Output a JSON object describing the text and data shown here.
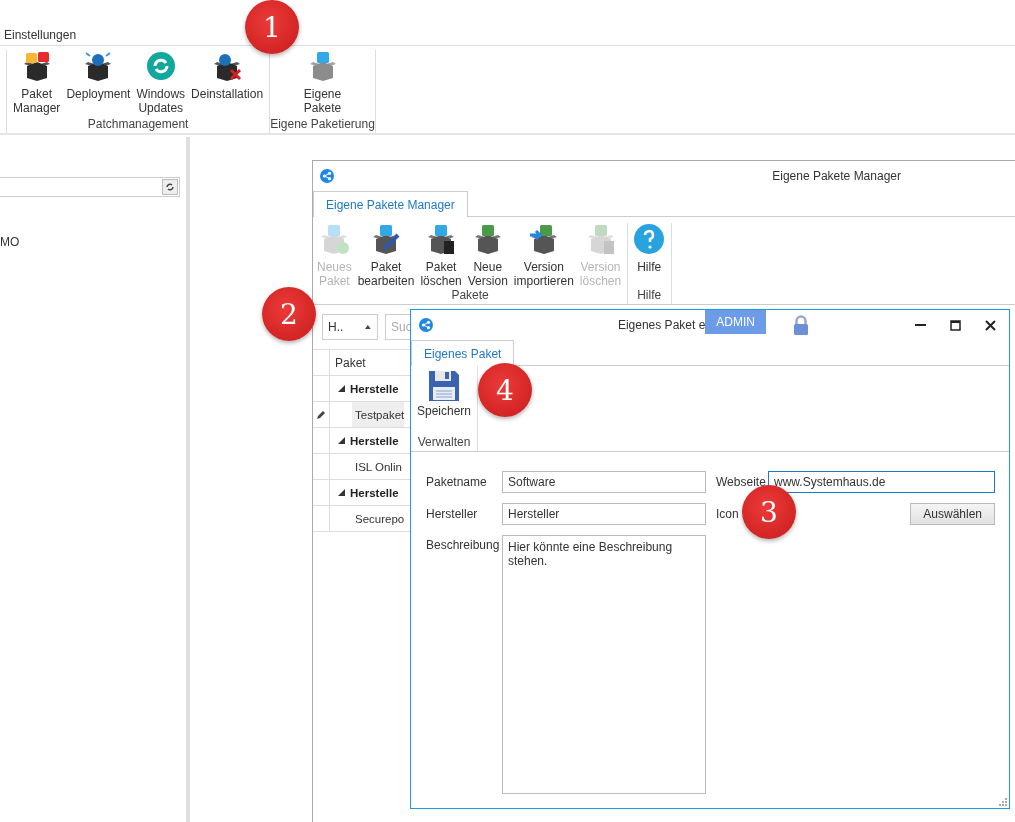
{
  "menu_tab": "Einstellungen",
  "ribbon_groups": [
    {
      "label": "Patchmanagement",
      "buttons": [
        {
          "label": "Paket\nManager",
          "kind": "packages"
        },
        {
          "label": "Deployment",
          "kind": "deploy"
        },
        {
          "label": "Windows\nUpdates",
          "kind": "updates"
        },
        {
          "label": "Deinstallation",
          "kind": "uninstall"
        }
      ]
    },
    {
      "label": "Eigene Paketierung",
      "buttons": [
        {
          "label": "Eigene\nPakete",
          "kind": "own"
        }
      ]
    }
  ],
  "left_panel": {
    "tree_item": "MO"
  },
  "manager": {
    "title": "Eigene Pakete Manager",
    "tabs": [
      {
        "label": "Eigene Pakete Manager",
        "selected": true
      }
    ],
    "ribbon_groups": [
      {
        "label": "Pakete",
        "buttons": [
          {
            "label": "Neues\nPaket",
            "kind": "new",
            "disabled": true
          },
          {
            "label": "Paket\nbearbeiten",
            "kind": "edit",
            "disabled": false
          },
          {
            "label": "Paket\nlöschen",
            "kind": "delete",
            "disabled": false
          },
          {
            "label": "Neue\nVersion",
            "kind": "version",
            "disabled": false
          },
          {
            "label": "Version\nimportieren",
            "kind": "import",
            "disabled": false
          },
          {
            "label": "Version\nlöschen",
            "kind": "delete_version",
            "disabled": true
          }
        ]
      },
      {
        "label": "Hilfe",
        "buttons": [
          {
            "label": "Hilfe",
            "kind": "help",
            "disabled": false
          }
        ]
      }
    ],
    "sort_dropdown": "H..",
    "search": {
      "placeholder": "Suc"
    },
    "column": "Paket",
    "rows": [
      {
        "kind": "group",
        "label": "Herstelle",
        "expanded": true,
        "children": [
          {
            "kind": "item",
            "label": "Testpaket",
            "selected": true,
            "editing": true
          }
        ]
      },
      {
        "kind": "group",
        "label": "Herstelle",
        "expanded": true,
        "children": [
          {
            "kind": "item",
            "label": "ISL Onlin",
            "selected": false,
            "editing": false
          }
        ]
      },
      {
        "kind": "group",
        "label": "Herstelle",
        "expanded": true,
        "children": [
          {
            "kind": "item",
            "label": "Securepo",
            "selected": false,
            "editing": false
          }
        ]
      }
    ]
  },
  "dialog": {
    "title": "Eigenes Paket e",
    "user_badge": "ADMIN",
    "tabs": [
      {
        "label": "Eigenes Paket",
        "selected": true
      }
    ],
    "ribbon_group": {
      "label": "Verwalten",
      "buttons": [
        {
          "label": "Speichern"
        }
      ]
    },
    "form": {
      "paketname": {
        "label": "Paketname",
        "value": "Software"
      },
      "hersteller": {
        "label": "Hersteller",
        "value": "Hersteller"
      },
      "beschreibung": {
        "label": "Beschreibung",
        "value": "Hier könnte eine Beschreibung stehen."
      },
      "webseite": {
        "label": "Webseite",
        "value": "www.Systemhaus.de",
        "focused": true
      },
      "icon": {
        "label": "Icon",
        "button": "Auswählen"
      }
    }
  },
  "callouts": [
    "1",
    "2",
    "3",
    "4"
  ]
}
